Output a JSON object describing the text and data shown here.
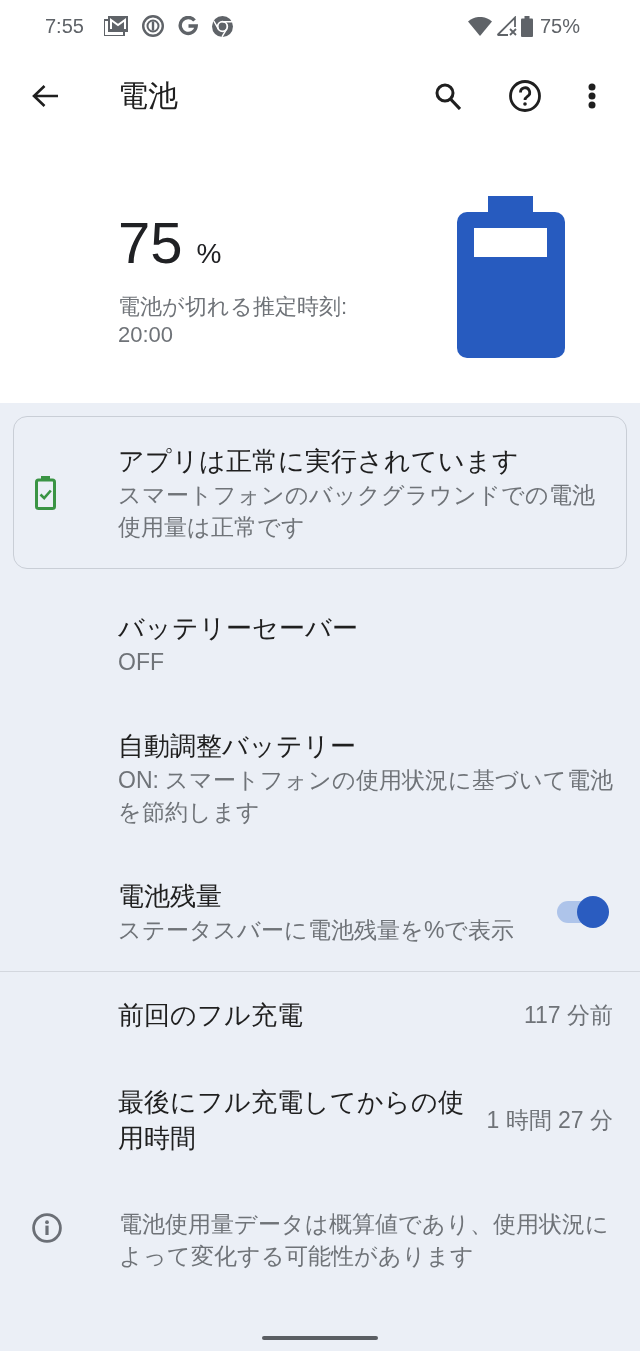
{
  "status_bar": {
    "time": "7:55",
    "battery_text": "75%"
  },
  "toolbar": {
    "title": "電池"
  },
  "summary": {
    "percent": "75",
    "unit": "%",
    "estimate": "電池が切れる推定時刻: 20:00"
  },
  "status_card": {
    "title": "アプリは正常に実行されています",
    "description": "スマートフォンのバックグラウンドでの電池使用量は正常です"
  },
  "settings": [
    {
      "kind": "text",
      "title": "バッテリーセーバー",
      "summary": "OFF"
    },
    {
      "kind": "text",
      "title": "自動調整バッテリー",
      "summary": "ON: スマートフォンの使用状況に基づいて電池を節約します"
    },
    {
      "kind": "switch",
      "title": "電池残量",
      "summary": "ステータスバーに電池残量を%で表示",
      "on": true
    }
  ],
  "usage": [
    {
      "label": "前回のフル充電",
      "value": "117 分前"
    },
    {
      "label": "最後にフル充電してからの使用時間",
      "value": "1 時間 27 分"
    }
  ],
  "note": {
    "text": "電池使用量データは概算値であり、使用状況によって変化する可能性があります"
  }
}
